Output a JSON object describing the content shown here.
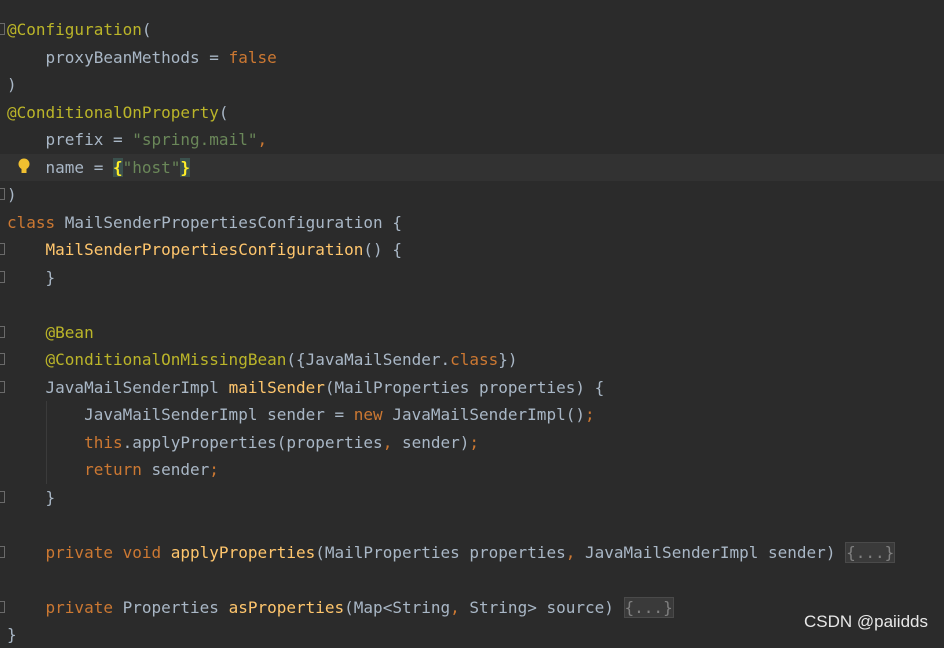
{
  "editor": {
    "language": "java",
    "lines": [
      {
        "gutter": "fold",
        "tokens": [
          {
            "t": "@Configuration",
            "c": "ann"
          },
          {
            "t": "("
          }
        ]
      },
      {
        "tokens": [
          {
            "t": "    proxyBeanMethods = "
          },
          {
            "t": "false",
            "c": "kw"
          }
        ]
      },
      {
        "tokens": [
          {
            "t": ")"
          }
        ]
      },
      {
        "tokens": [
          {
            "t": "@ConditionalOnProperty",
            "c": "ann"
          },
          {
            "t": "("
          }
        ]
      },
      {
        "tokens": [
          {
            "t": "    prefix = "
          },
          {
            "t": "\"spring.mail\"",
            "c": "str"
          },
          {
            "t": ",",
            "c": "kw"
          }
        ]
      },
      {
        "current": true,
        "bulb": true,
        "tokens": [
          {
            "t": "    name = "
          },
          {
            "t": "{",
            "c": "brace-hl"
          },
          {
            "t": "\"host\"",
            "c": "str"
          },
          {
            "t": "}",
            "c": "brace-hl"
          }
        ]
      },
      {
        "gutter": "fold",
        "tokens": [
          {
            "t": ")"
          }
        ]
      },
      {
        "tokens": [
          {
            "t": "class ",
            "c": "kw"
          },
          {
            "t": "MailSenderPropertiesConfiguration {"
          }
        ]
      },
      {
        "gutter": "fold",
        "tokens": [
          {
            "t": "    "
          },
          {
            "t": "MailSenderPropertiesConfiguration",
            "c": "fn"
          },
          {
            "t": "() {"
          }
        ]
      },
      {
        "gutter": "fold",
        "tokens": [
          {
            "t": "    }"
          }
        ]
      },
      {
        "tokens": []
      },
      {
        "gutter": "fold",
        "tokens": [
          {
            "t": "    "
          },
          {
            "t": "@Bean",
            "c": "ann"
          }
        ]
      },
      {
        "gutter": "fold",
        "tokens": [
          {
            "t": "    "
          },
          {
            "t": "@ConditionalOnMissingBean",
            "c": "ann"
          },
          {
            "t": "({JavaMailSender."
          },
          {
            "t": "class",
            "c": "kw"
          },
          {
            "t": "})"
          }
        ]
      },
      {
        "gutter": "fold",
        "tokens": [
          {
            "t": "    JavaMailSenderImpl "
          },
          {
            "t": "mailSender",
            "c": "fn"
          },
          {
            "t": "(MailProperties properties) {"
          }
        ]
      },
      {
        "tokens": [
          {
            "t": "        JavaMailSenderImpl sender = "
          },
          {
            "t": "new ",
            "c": "kw"
          },
          {
            "t": "JavaMailSenderImpl()"
          },
          {
            "t": ";",
            "c": "kw"
          }
        ]
      },
      {
        "tokens": [
          {
            "t": "        "
          },
          {
            "t": "this",
            "c": "kw"
          },
          {
            "t": ".applyProperties(properties"
          },
          {
            "t": ",",
            "c": "kw"
          },
          {
            "t": " sender)"
          },
          {
            "t": ";",
            "c": "kw"
          }
        ]
      },
      {
        "tokens": [
          {
            "t": "        "
          },
          {
            "t": "return ",
            "c": "kw"
          },
          {
            "t": "sender"
          },
          {
            "t": ";",
            "c": "kw"
          }
        ]
      },
      {
        "gutter": "fold",
        "tokens": [
          {
            "t": "    }"
          }
        ]
      },
      {
        "tokens": []
      },
      {
        "gutter": "fold",
        "tokens": [
          {
            "t": "    "
          },
          {
            "t": "private void ",
            "c": "kw"
          },
          {
            "t": "applyProperties",
            "c": "fn"
          },
          {
            "t": "(MailProperties properties"
          },
          {
            "t": ",",
            "c": "kw"
          },
          {
            "t": " JavaMailSenderImpl sender) "
          },
          {
            "t": "{...}",
            "c": "fold"
          }
        ]
      },
      {
        "tokens": []
      },
      {
        "gutter": "fold",
        "tokens": [
          {
            "t": "    "
          },
          {
            "t": "private ",
            "c": "kw"
          },
          {
            "t": "Properties "
          },
          {
            "t": "asProperties",
            "c": "fn"
          },
          {
            "t": "(Map<String"
          },
          {
            "t": ",",
            "c": "kw"
          },
          {
            "t": " String> source) "
          },
          {
            "t": "{...}",
            "c": "fold"
          }
        ]
      },
      {
        "tokens": [
          {
            "t": "}"
          }
        ]
      }
    ]
  },
  "watermark": "CSDN @paiidds"
}
